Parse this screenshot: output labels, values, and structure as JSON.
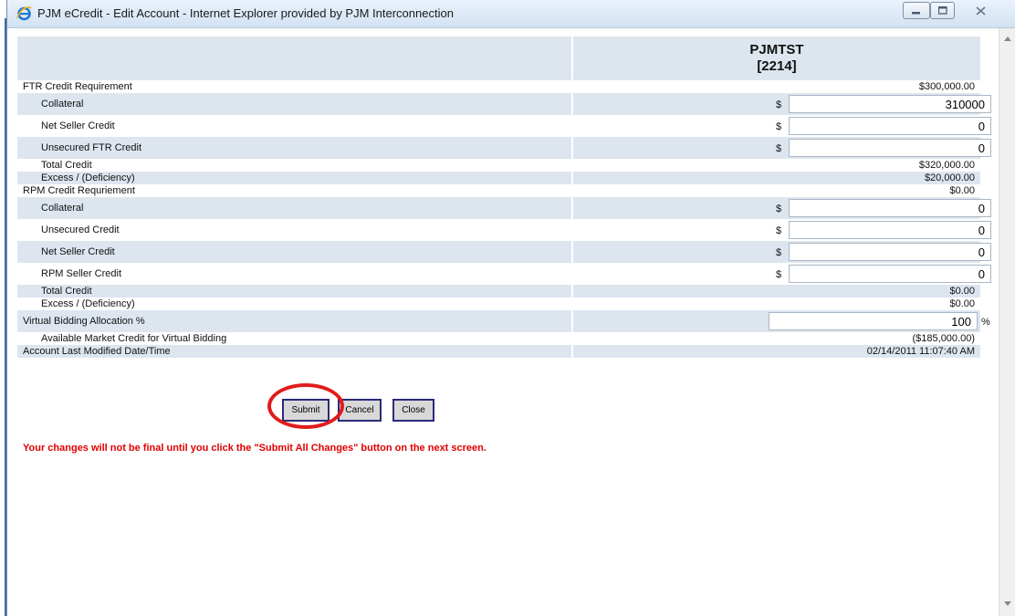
{
  "window": {
    "title": "PJM eCredit - Edit Account - Internet Explorer provided by PJM Interconnection"
  },
  "account": {
    "name": "PJMTST",
    "id": "[2214]"
  },
  "rows": {
    "ftr_req_label": "FTR Credit Requirement",
    "ftr_req_value": "$300,000.00",
    "ftr_collateral_label": "Collateral",
    "ftr_collateral_value": "310000",
    "ftr_net_seller_label": "Net Seller Credit",
    "ftr_net_seller_value": "0",
    "ftr_unsecured_label": "Unsecured FTR Credit",
    "ftr_unsecured_value": "0",
    "ftr_total_label": "Total Credit",
    "ftr_total_value": "$320,000.00",
    "ftr_excess_label": "Excess / (Deficiency)",
    "ftr_excess_value": "$20,000.00",
    "rpm_req_label": "RPM Credit Requriement",
    "rpm_req_value": "$0.00",
    "rpm_collateral_label": "Collateral",
    "rpm_collateral_value": "0",
    "rpm_unsecured_label": "Unsecured Credit",
    "rpm_unsecured_value": "0",
    "rpm_net_seller_label": "Net Seller Credit",
    "rpm_net_seller_value": "0",
    "rpm_seller_label": "RPM Seller Credit",
    "rpm_seller_value": "0",
    "rpm_total_label": "Total Credit",
    "rpm_total_value": "$0.00",
    "rpm_excess_label": "Excess / (Deficiency)",
    "rpm_excess_value": "$0.00",
    "vb_alloc_label": "Virtual Bidding Allocation %",
    "vb_alloc_value": "100",
    "avail_label": "Available Market Credit for Virtual Bidding",
    "avail_value": "($185,000.00)",
    "modified_label": "Account Last Modified Date/Time",
    "modified_value": "02/14/2011 11:07:40 AM"
  },
  "symbols": {
    "dollar": "$",
    "percent": "%"
  },
  "buttons": {
    "submit": "Submit",
    "cancel": "Cancel",
    "close": "Close"
  },
  "warning": "Your changes will not be final until you click the \"Submit All Changes\" button on the next screen.",
  "colors": {
    "row_shade": "#dde6ef",
    "warning_red": "#e00000",
    "highlight_circle": "#e21b1b"
  },
  "icons": {
    "browser": "internet-explorer-icon",
    "minimize": "minimize-icon",
    "maximize": "maximize-icon",
    "close": "close-icon"
  }
}
